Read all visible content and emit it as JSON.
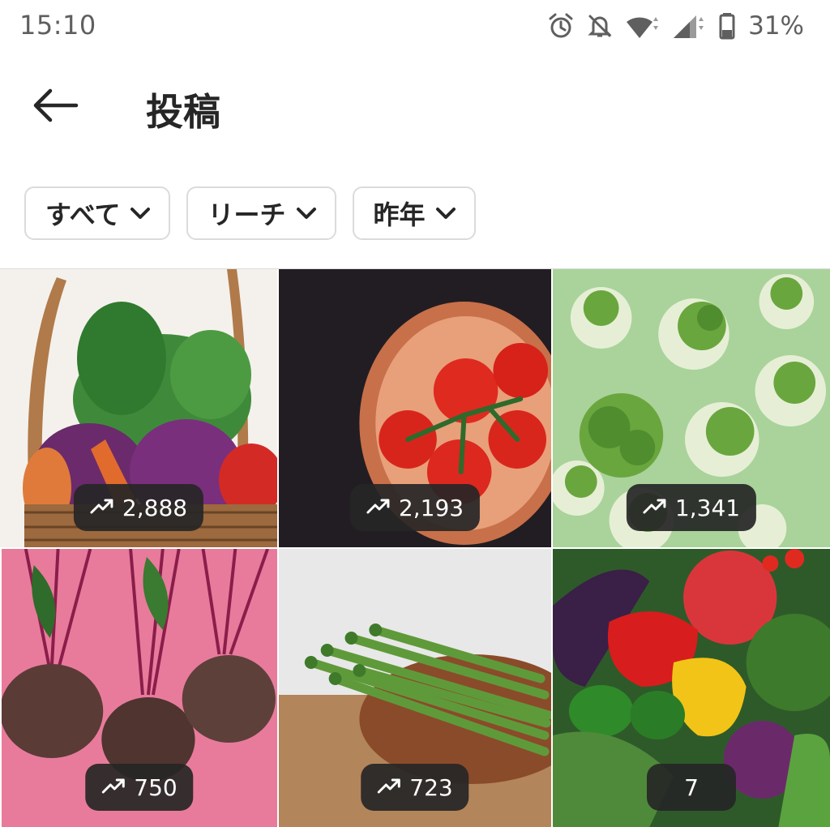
{
  "status_bar": {
    "time": "15:10",
    "battery": "31%"
  },
  "header": {
    "title": "投稿"
  },
  "filters": [
    {
      "label": "すべて"
    },
    {
      "label": "リーチ"
    },
    {
      "label": "昨年"
    }
  ],
  "posts": [
    {
      "subject": "vegetable basket",
      "reach": "2,888",
      "trend_icon": true
    },
    {
      "subject": "tomatoes in wooden bowl",
      "reach": "2,193",
      "trend_icon": true
    },
    {
      "subject": "broccoli florets",
      "reach": "1,341",
      "trend_icon": true
    },
    {
      "subject": "beetroots",
      "reach": "750",
      "trend_icon": true
    },
    {
      "subject": "asparagus",
      "reach": "723",
      "trend_icon": true
    },
    {
      "subject": "mixed vegetables",
      "reach": "7",
      "trend_icon": false
    }
  ]
}
